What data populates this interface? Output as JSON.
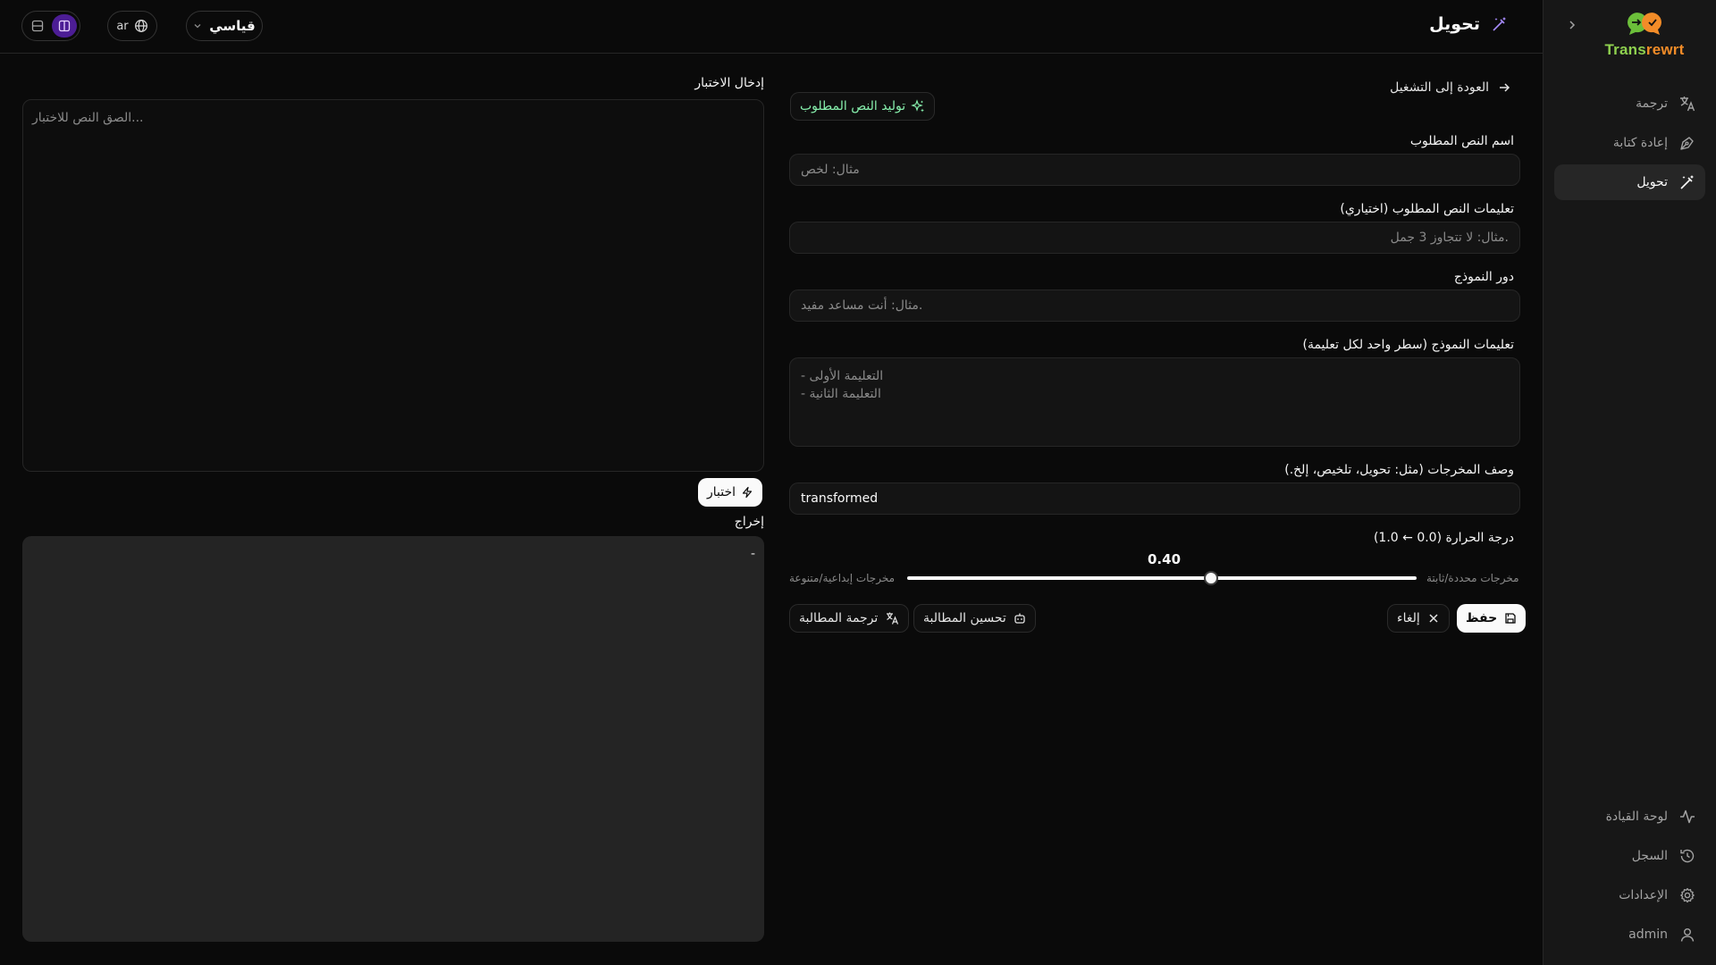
{
  "sidebar": {
    "logo": {
      "brand_a": "Trans",
      "brand_b": "rewrt"
    },
    "nav_top": [
      {
        "label": "ترجمة",
        "icon": "translate-icon"
      },
      {
        "label": "إعادة كتابة",
        "icon": "pen-tool-icon"
      },
      {
        "label": "تحويل",
        "icon": "wand-icon",
        "active": true
      }
    ],
    "nav_bottom": [
      {
        "label": "لوحة القيادة",
        "icon": "activity-icon"
      },
      {
        "label": "السجل",
        "icon": "history-icon"
      },
      {
        "label": "الإعدادات",
        "icon": "gear-icon"
      },
      {
        "label": "admin",
        "icon": "user-icon"
      }
    ]
  },
  "header": {
    "title": "تحويل",
    "language": "ar",
    "mode": "قياسي"
  },
  "form": {
    "back_label": "العودة إلى التشغيل",
    "generate_label": "توليد النص المطلوب",
    "name_label": "اسم النص المطلوب",
    "name_placeholder": "مثال: لخص",
    "instructions_label": "تعليمات النص المطلوب (اختياري)",
    "instructions_placeholder": "مثال: لا تتجاوز 3 جمل.",
    "role_label": "دور النموذج",
    "role_placeholder": "مثال: أنت مساعد مفيد.",
    "model_instructions_label": "تعليمات النموذج (سطر واحد لكل تعليمة)",
    "model_instructions_line1": "- التعليمة الأولى",
    "model_instructions_line2": "- التعليمة الثانية",
    "output_desc_label": "وصف المخرجات (مثل: تحويل، تلخيص، إلخ.)",
    "output_desc_value": "transformed",
    "temperature_label": "درجة الحرارة (0.0 ← 1.0)",
    "temperature_value": "0.40",
    "temperature": 0.4,
    "temp_low_note": "مخرجات محددة/ثابتة",
    "temp_high_note": "مخرجات إبداعية/متنوعة",
    "save_label": "حفظ",
    "cancel_label": "إلغاء",
    "improve_label": "تحسين المطالبة",
    "translate_label": "ترجمة المطالبة"
  },
  "test": {
    "input_label": "إدخال الاختبار",
    "input_placeholder": "الصق النص للاختبار...",
    "test_button": "اختبار",
    "output_label": "إخراج",
    "output_value": "-"
  }
}
